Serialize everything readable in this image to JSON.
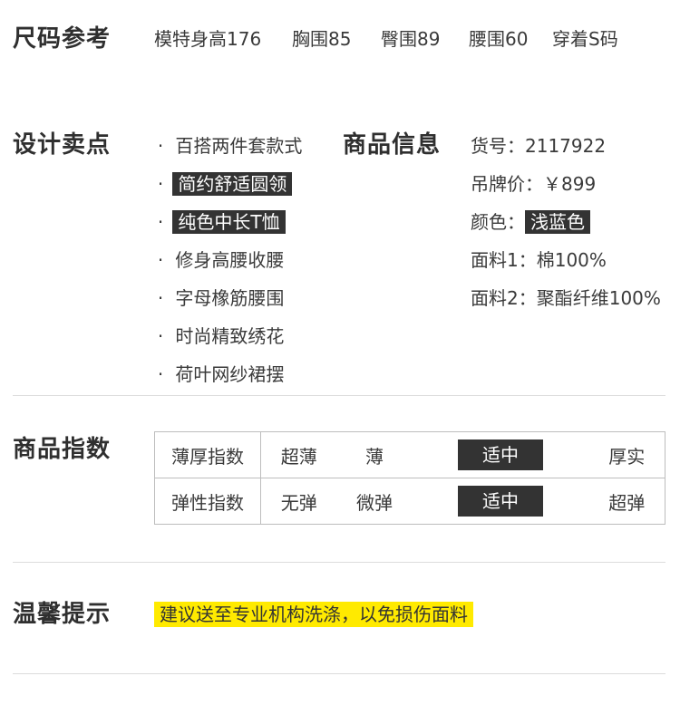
{
  "size": {
    "heading": "尺码参考",
    "items": [
      "模特身高176",
      "胸围85",
      "臀围89",
      "腰围60",
      "穿着S码"
    ]
  },
  "design": {
    "heading": "设计卖点",
    "bullet": "·",
    "points": [
      "百搭两件套款式",
      "简约舒适圆领",
      "纯色中长T恤",
      "修身高腰收腰",
      "字母橡筋腰围",
      "时尚精致绣花",
      "荷叶网纱裙摆"
    ]
  },
  "product": {
    "heading": "商品信息",
    "sku_label": "货号：",
    "sku": "2117922",
    "price_label": "吊牌价：",
    "price": "￥899",
    "color_label": "颜色：",
    "color": "浅蓝色",
    "fabric1_label": "面料1：",
    "fabric1": "棉100%",
    "fabric2_label": "面料2：",
    "fabric2": "聚酯纤维100%"
  },
  "index": {
    "heading": "商品指数",
    "rows": [
      {
        "label": "薄厚指数",
        "options": [
          "超薄",
          "薄",
          "适中",
          "厚实"
        ],
        "selected": 2
      },
      {
        "label": "弹性指数",
        "options": [
          "无弹",
          "微弹",
          "适中",
          "超弹"
        ],
        "selected": 2
      }
    ]
  },
  "tips": {
    "heading": "温馨提示",
    "text": "建议送至专业机构洗涤，以免损伤面料"
  },
  "colors": {
    "dark_highlight": "#333333",
    "yellow_highlight": "#ffea00",
    "divider": "#dcdcdc"
  }
}
